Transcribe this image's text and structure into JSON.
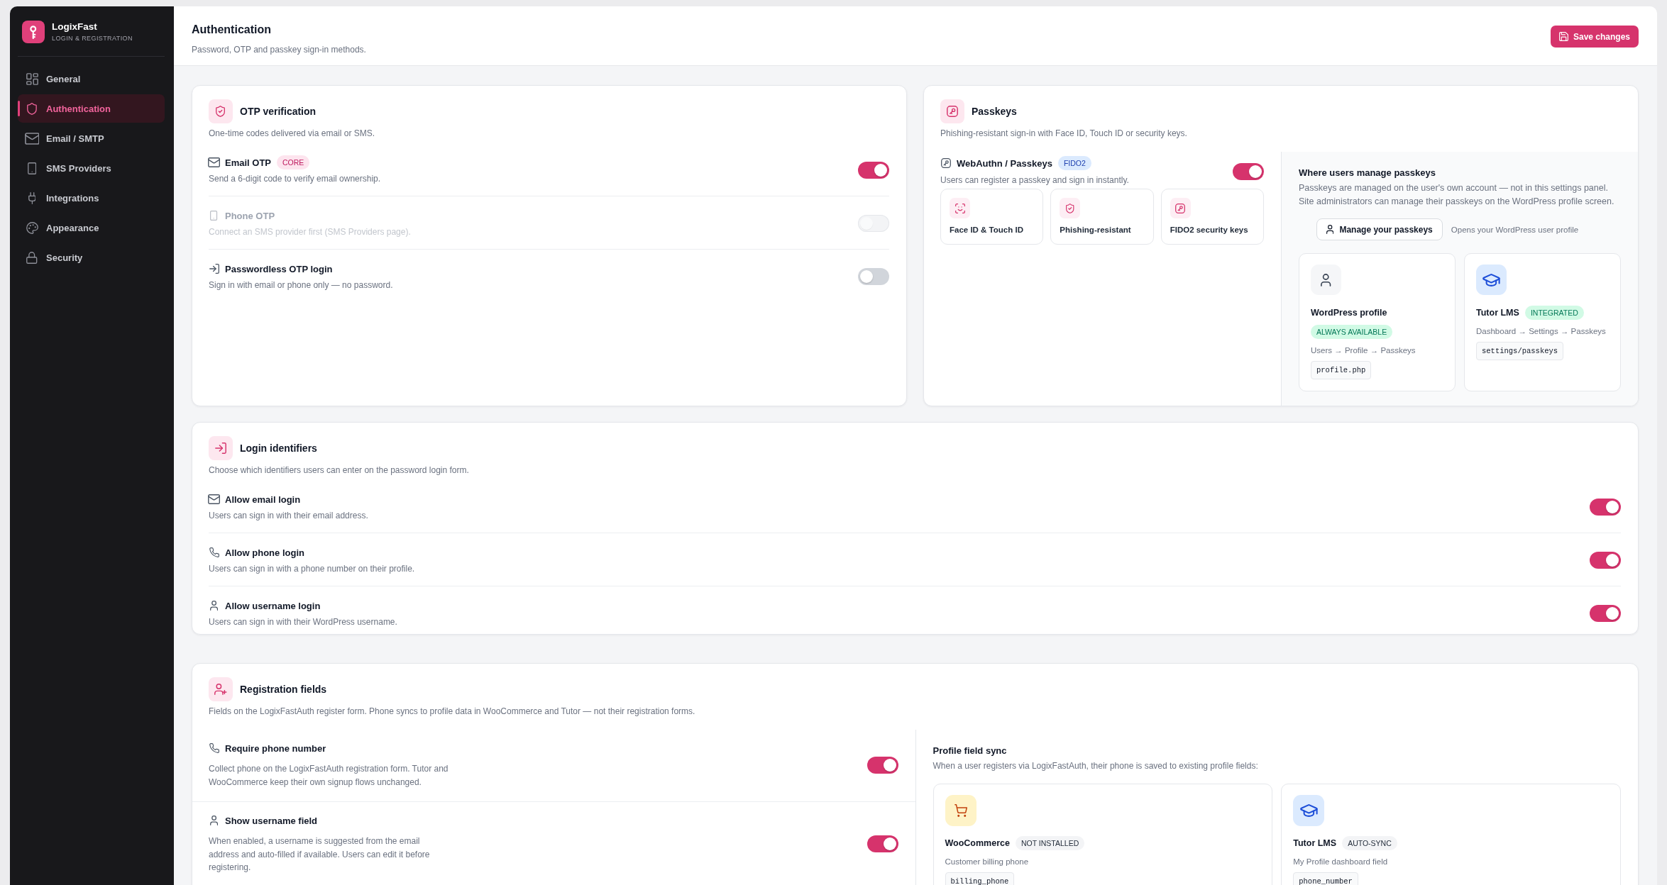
{
  "sidebar": {
    "brand": {
      "name": "LogixFast",
      "tagline": "LOGIN & REGISTRATION"
    },
    "items": [
      {
        "label": "General",
        "selected": false
      },
      {
        "label": "Authentication",
        "selected": true
      },
      {
        "label": "Email / SMTP",
        "selected": false
      },
      {
        "label": "SMS Providers",
        "selected": false
      },
      {
        "label": "Integrations",
        "selected": false
      },
      {
        "label": "Appearance",
        "selected": false
      },
      {
        "label": "Security",
        "selected": false
      }
    ]
  },
  "header": {
    "title": "Authentication",
    "subtitle": "Password, OTP and passkey sign-in methods.",
    "save_button": "Save changes"
  },
  "otp_verification": {
    "title": "OTP verification",
    "description": "One-time codes delivered via email or SMS.",
    "options": [
      {
        "label": "Email OTP",
        "badge": {
          "text": "CORE",
          "kind": "accent"
        },
        "description": "Send a 6-digit code to verify email ownership.",
        "on": true,
        "disabled": false
      },
      {
        "label": "Phone OTP",
        "description": "Connect an SMS provider first (SMS Providers page).",
        "on": false,
        "disabled": true
      },
      {
        "label": "Passwordless OTP login",
        "description": "Sign in with email or phone only — no password.",
        "on": false,
        "disabled": false
      }
    ]
  },
  "passkeys": {
    "title": "Passkeys",
    "description": "Phishing-resistant sign-in with Face ID, Touch ID or security keys.",
    "webauthn": {
      "label": "WebAuthn / Passkeys",
      "badge": {
        "text": "FIDO2",
        "kind": "info"
      },
      "description": "Users can register a passkey and sign in instantly.",
      "on": true
    },
    "features": [
      "Face ID & Touch ID",
      "Phishing-resistant",
      "FIDO2 security keys"
    ],
    "manage": {
      "title": "Where users manage passkeys",
      "description": "Passkeys are managed on the user's own account — not in this settings panel. Site administrators can manage their passkeys on the WordPress profile screen.",
      "button": "Manage your passkeys",
      "hint": "Opens your WordPress user profile",
      "locations": [
        {
          "name": "WordPress profile",
          "badge": {
            "text": "ALWAYS AVAILABLE",
            "kind": "success"
          },
          "path": "Users → Profile → Passkeys",
          "code": "profile.php"
        },
        {
          "name": "Tutor LMS",
          "badge": {
            "text": "INTEGRATED",
            "kind": "success"
          },
          "path": "Dashboard → Settings → Passkeys",
          "code": "settings/passkeys"
        }
      ]
    }
  },
  "login_identifiers": {
    "title": "Login identifiers",
    "description": "Choose which identifiers users can enter on the password login form.",
    "options": [
      {
        "label": "Allow email login",
        "description": "Users can sign in with their email address.",
        "on": true
      },
      {
        "label": "Allow phone login",
        "description": "Users can sign in with a phone number on their profile.",
        "on": true
      },
      {
        "label": "Allow username login",
        "description": "Users can sign in with their WordPress username.",
        "on": true
      }
    ]
  },
  "registration_fields": {
    "title": "Registration fields",
    "description": "Fields on the LogixFastAuth register form. Phone syncs to profile data in WooCommerce and Tutor — not their registration forms.",
    "options": [
      {
        "label": "Require phone number",
        "description": "Collect phone on the LogixFastAuth registration form. Tutor and WooCommerce keep their own signup flows unchanged.",
        "on": true
      },
      {
        "label": "Show username field",
        "description": "When enabled, a username is suggested from the email address and auto-filled if available. Users can edit it before registering.",
        "on": true
      }
    ],
    "profile_sync": {
      "title": "Profile field sync",
      "description": "When a user registers via LogixFastAuth, their phone is saved to existing profile fields:",
      "integrations": [
        {
          "name": "WooCommerce",
          "badge": {
            "text": "NOT INSTALLED",
            "kind": "neutral"
          },
          "field": "Customer billing phone",
          "code": "billing_phone"
        },
        {
          "name": "Tutor LMS",
          "badge": {
            "text": "AUTO-SYNC",
            "kind": "neutral"
          },
          "field": "My Profile dashboard field",
          "code": "phone_number"
        }
      ]
    }
  }
}
